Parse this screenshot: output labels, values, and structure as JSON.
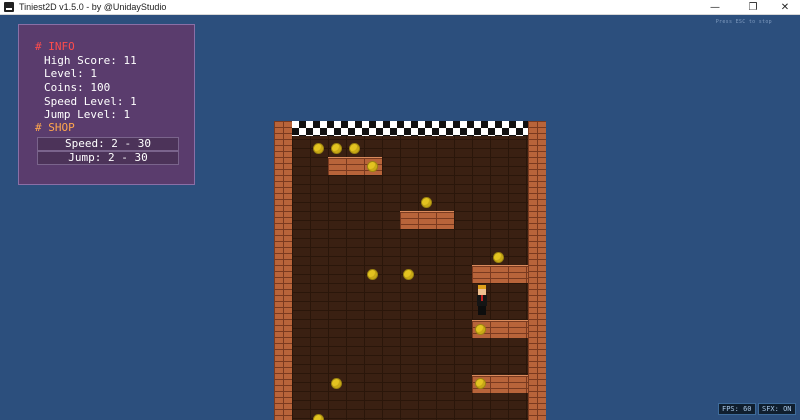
{
  "window": {
    "title": "Tiniest2D v1.5.0 - by @UnidayStudio",
    "minimize_glyph": "—",
    "restore_glyph": "❐",
    "close_glyph": "✕"
  },
  "hint": "Press ESC to stop",
  "info": {
    "header": "# INFO",
    "high_score": "High Score: 11",
    "level": "Level: 1",
    "coins": "Coins: 100",
    "speed_level": "Speed Level: 1",
    "jump_level": "Jump Level: 1"
  },
  "shop": {
    "header": "# SHOP",
    "speed": "Speed: 2 - 30",
    "jump": "Jump: 2 - 30"
  },
  "status": {
    "fps": "FPS: 60",
    "sfx": "SFX: ON"
  },
  "colors": {
    "background": "#2c4f7d",
    "info_header": "#ff4c4c",
    "shop_header": "#ffa64d",
    "coin": "#e3c320",
    "brick": "#b8643a"
  }
}
